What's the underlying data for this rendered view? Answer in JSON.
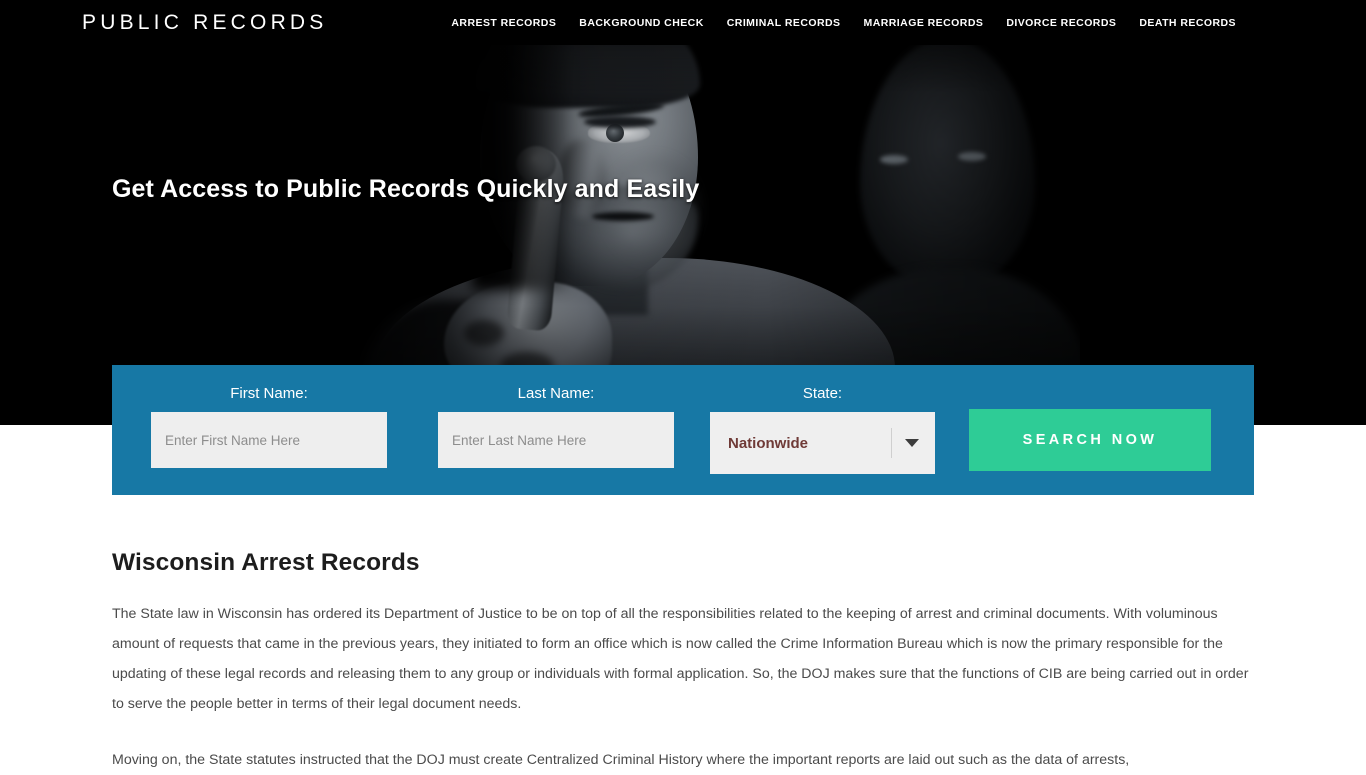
{
  "header": {
    "brand": "PUBLIC RECORDS",
    "nav": [
      {
        "label": "ARREST RECORDS"
      },
      {
        "label": "BACKGROUND CHECK"
      },
      {
        "label": "CRIMINAL RECORDS"
      },
      {
        "label": "MARRIAGE RECORDS"
      },
      {
        "label": "DIVORCE RECORDS"
      },
      {
        "label": "DEATH RECORDS"
      }
    ]
  },
  "hero": {
    "headline": "Get Access to Public Records Quickly and Easily",
    "image_alt": "man-shushing-finger-to-lips"
  },
  "search_form": {
    "first_name": {
      "label": "First Name:",
      "placeholder": "Enter First Name Here",
      "value": ""
    },
    "last_name": {
      "label": "Last Name:",
      "placeholder": "Enter Last Name Here",
      "value": ""
    },
    "state": {
      "label": "State:",
      "selected": "Nationwide",
      "arrow_icon": "chevron-down-icon"
    },
    "submit_label": "SEARCH NOW"
  },
  "main": {
    "title": "Wisconsin Arrest Records",
    "paragraphs": [
      "The State law in Wisconsin has ordered its Department of Justice to be on top of all the responsibilities related to the keeping of arrest and criminal documents. With voluminous amount of requests that came in the previous years, they initiated to form an office which is now called the Crime Information Bureau which is now the primary responsible for the updating of these legal records and releasing them to any group or individuals with formal application. So, the DOJ makes sure that the functions of CIB are being carried out in order to serve the people better in terms of their legal document needs.",
      "Moving on, the State statutes instructed that the DOJ must create Centralized Criminal History where the important reports are laid out such as the data of arrests,"
    ]
  },
  "colors": {
    "form_blue": "#1778a5",
    "button_green": "#2ecc96",
    "header_black": "#000000",
    "select_text": "#6f3a37",
    "page_background": "#ffffff"
  }
}
